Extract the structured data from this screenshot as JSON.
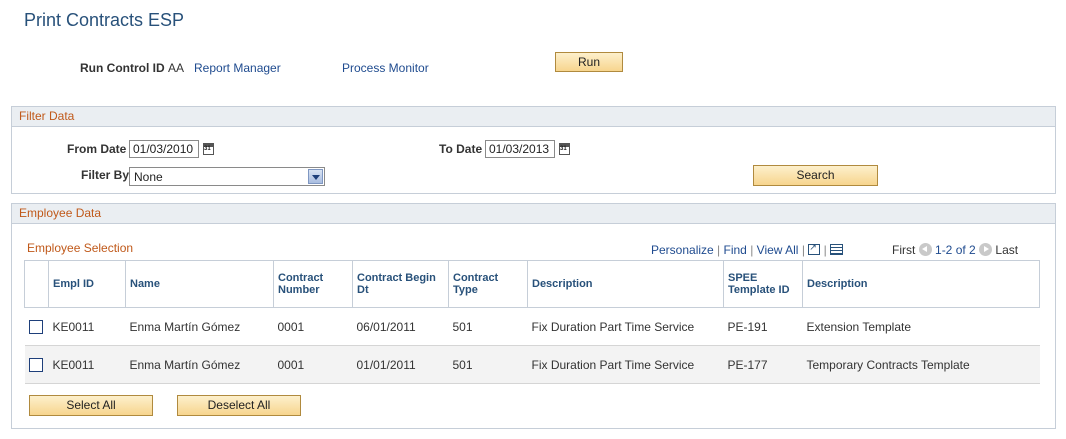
{
  "page": {
    "title": "Print Contracts ESP"
  },
  "run_control": {
    "label": "Run Control ID",
    "value": "AA",
    "report_manager": "Report Manager",
    "process_monitor": "Process Monitor",
    "run_button": "Run"
  },
  "filter": {
    "header": "Filter Data",
    "from_date_label": "From Date",
    "from_date_value": "01/03/2010",
    "to_date_label": "To Date",
    "to_date_value": "01/03/2013",
    "filter_by_label": "Filter By",
    "filter_by_value": "None",
    "search_button": "Search"
  },
  "employee": {
    "header": "Employee Data",
    "grid_title": "Employee Selection",
    "nav": {
      "personalize": "Personalize",
      "find": "Find",
      "view_all": "View All",
      "first": "First",
      "range": "1-2 of 2",
      "last": "Last"
    },
    "columns": [
      "Empl ID",
      "Name",
      "Contract Number",
      "Contract Begin Dt",
      "Contract Type",
      "Description",
      "SPEE Template ID",
      "Description"
    ],
    "rows": [
      [
        "KE0011",
        "Enma Martín Gómez",
        "0001",
        "06/01/2011",
        "501",
        "Fix Duration Part Time Service",
        "PE-191",
        "Extension Template"
      ],
      [
        "KE0011",
        "Enma Martín Gómez",
        "0001",
        "01/01/2011",
        "501",
        "Fix Duration Part Time Service",
        "PE-177",
        "Temporary Contracts Template"
      ]
    ],
    "select_all": "Select All",
    "deselect_all": "Deselect All"
  }
}
